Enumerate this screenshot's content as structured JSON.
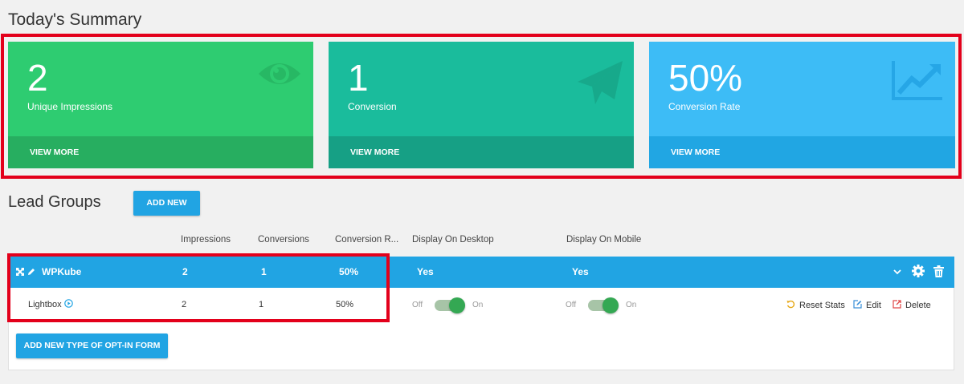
{
  "summary": {
    "title": "Today's Summary",
    "cards": [
      {
        "value": "2",
        "label": "Unique Impressions",
        "link": "VIEW MORE",
        "icon": "eye-icon",
        "color": "#2ecc71"
      },
      {
        "value": "1",
        "label": "Conversion",
        "link": "VIEW MORE",
        "icon": "paper-plane-icon",
        "color": "#1abc9c"
      },
      {
        "value": "50%",
        "label": "Conversion Rate",
        "link": "VIEW MORE",
        "icon": "line-chart-icon",
        "color": "#3dbcf6"
      }
    ]
  },
  "lead_groups": {
    "title": "Lead Groups",
    "add_new": "ADD NEW",
    "columns": [
      "Impressions",
      "Conversions",
      "Conversion R...",
      "Display On Desktop",
      "Display On Mobile"
    ],
    "group": {
      "name": "WPKube",
      "impressions": "2",
      "conversions": "1",
      "conversion_rate": "50%",
      "desktop": "Yes",
      "mobile": "Yes"
    },
    "form": {
      "name": "Lightbox",
      "impressions": "2",
      "conversions": "1",
      "conversion_rate": "50%",
      "off_label": "Off",
      "on_label": "On",
      "actions": {
        "reset": "Reset Stats",
        "edit": "Edit",
        "delete": "Delete"
      }
    },
    "add_type": "ADD NEW TYPE OF OPT-IN FORM"
  },
  "colors": {
    "accent": "#21a4e3",
    "highlight": "#e3001b",
    "toggle_on": "#34a853"
  }
}
